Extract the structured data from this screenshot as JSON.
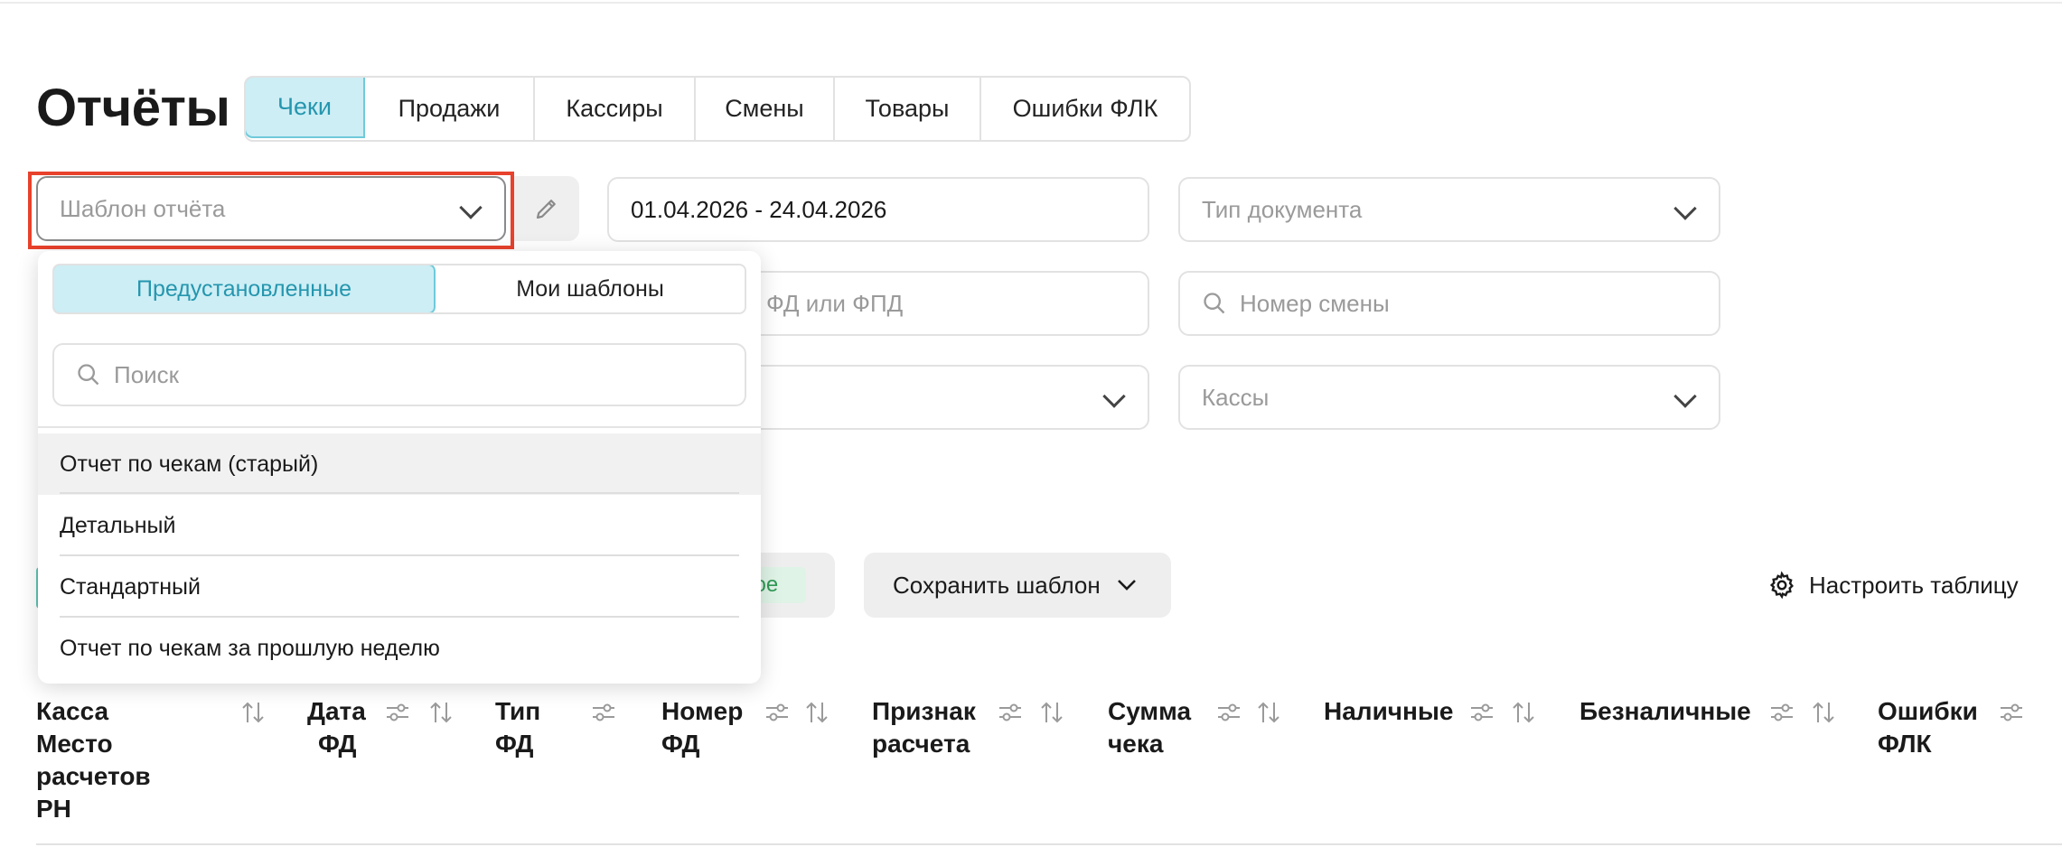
{
  "page": {
    "title": "Отчёты"
  },
  "tabs": [
    {
      "label": "Чеки",
      "active": true
    },
    {
      "label": "Продажи"
    },
    {
      "label": "Кассиры"
    },
    {
      "label": "Смены"
    },
    {
      "label": "Товары"
    },
    {
      "label": "Ошибки ФЛК"
    }
  ],
  "filters": {
    "template_placeholder": "Шаблон отчёта",
    "date_range": "01.04.2026 - 24.04.2026",
    "doc_type_placeholder": "Тип документа",
    "fd_placeholder": "ФД или ФПД",
    "shift_placeholder": "Номер смены",
    "cash_registers_placeholder": "Кассы"
  },
  "dropdown": {
    "segments": [
      "Предустановленные",
      "Мои шаблоны"
    ],
    "search_placeholder": "Поиск",
    "items": [
      "Отчет по чекам (старый)",
      "Детальный",
      "Стандартный",
      "Отчет по чекам за прошлую неделю"
    ]
  },
  "toolbar": {
    "badge_partial": "вое",
    "save_template": "Сохранить шаблон",
    "configure_table": "Настроить таблицу"
  },
  "table": {
    "columns": [
      {
        "lines": [
          "Касса",
          "Место",
          "расчетов",
          "РН"
        ]
      },
      {
        "lines": [
          "Дата",
          "ФД"
        ]
      },
      {
        "lines": [
          "Тип",
          "ФД"
        ]
      },
      {
        "lines": [
          "Номер",
          "ФД"
        ]
      },
      {
        "lines": [
          "Признак",
          "расчета"
        ]
      },
      {
        "lines": [
          "Сумма",
          "чека"
        ]
      },
      {
        "lines": [
          "Наличные"
        ]
      },
      {
        "lines": [
          "Безналичные"
        ]
      },
      {
        "lines": [
          "Ошибки",
          "ФЛК"
        ]
      }
    ]
  },
  "colors": {
    "accent": "#2596ae",
    "accent_bg": "#cdeef5",
    "highlight": "#e8412c"
  }
}
